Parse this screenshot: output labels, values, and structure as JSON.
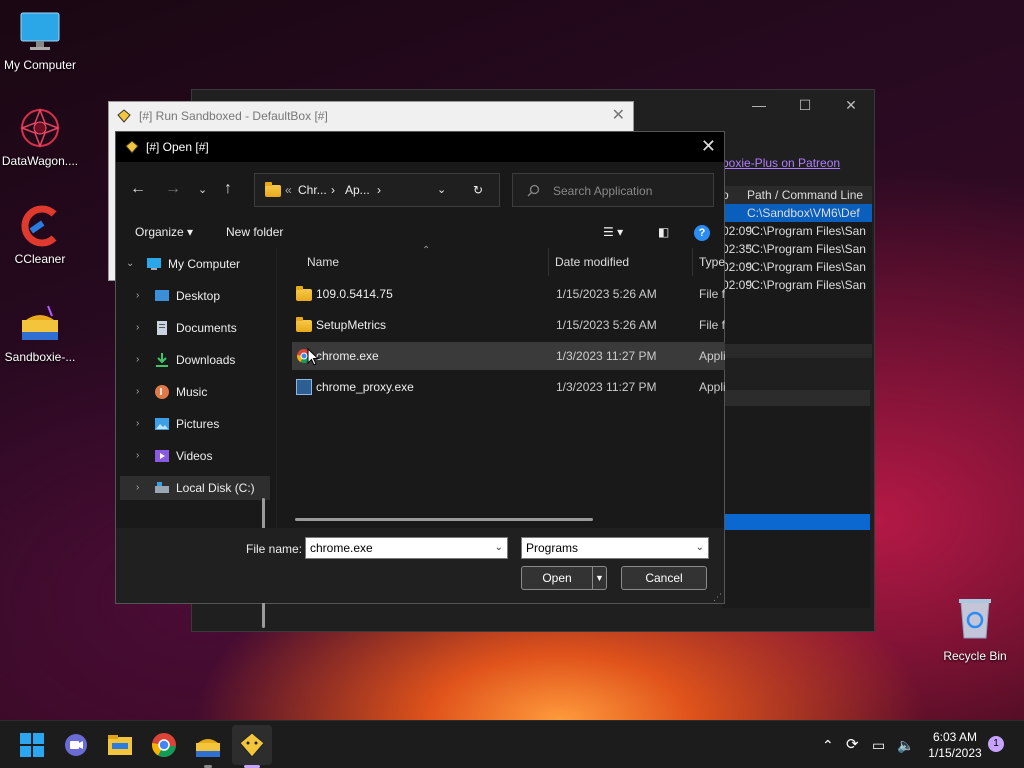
{
  "desktop": {
    "icons": [
      {
        "label": "My Computer"
      },
      {
        "label": "DataWagon...."
      },
      {
        "label": "CCleaner"
      },
      {
        "label": "Sandboxie-..."
      }
    ],
    "recycle_bin": "Recycle Bin"
  },
  "bg_window": {
    "link": "boxie-Plus on Patreon",
    "header_left": "o",
    "header_right": "Path / Command Line",
    "rows": [
      {
        "time": "",
        "path": "C:\\Sandbox\\VM6\\Def"
      },
      {
        "time": "02:09",
        "path": "\"C:\\Program Files\\San"
      },
      {
        "time": "02:35",
        "path": "\"C:\\Program Files\\San"
      },
      {
        "time": "02:09",
        "path": "\"C:\\Program Files\\San"
      },
      {
        "time": "02:09",
        "path": "\"C:\\Program Files\\San"
      }
    ]
  },
  "run_window": {
    "title": "[#] Run Sandboxed - DefaultBox [#]"
  },
  "dialog": {
    "title": "[#] Open [#]",
    "breadcrumb": [
      "«",
      "Chr...",
      "›",
      "Ap...",
      "›"
    ],
    "search_placeholder": "Search Application",
    "toolbar": {
      "organize": "Organize",
      "new_folder": "New folder"
    },
    "tree": [
      {
        "label": "My Computer"
      },
      {
        "label": "Desktop"
      },
      {
        "label": "Documents"
      },
      {
        "label": "Downloads"
      },
      {
        "label": "Music"
      },
      {
        "label": "Pictures"
      },
      {
        "label": "Videos"
      },
      {
        "label": "Local Disk (C:)"
      }
    ],
    "columns": {
      "name": "Name",
      "date": "Date modified",
      "type": "Type"
    },
    "files": [
      {
        "name": "109.0.5414.75",
        "date": "1/15/2023 5:26 AM",
        "type": "File folder"
      },
      {
        "name": "SetupMetrics",
        "date": "1/15/2023 5:26 AM",
        "type": "File folder"
      },
      {
        "name": "chrome.exe",
        "date": "1/3/2023 11:27 PM",
        "type": "Application"
      },
      {
        "name": "chrome_proxy.exe",
        "date": "1/3/2023 11:27 PM",
        "type": "Application"
      }
    ],
    "file_name_label": "File name:",
    "file_name_value": "chrome.exe",
    "filter": "Programs",
    "open_label": "Open",
    "cancel_label": "Cancel"
  },
  "taskbar": {
    "time": "6:03 AM",
    "date": "1/15/2023",
    "notifications": "1"
  }
}
